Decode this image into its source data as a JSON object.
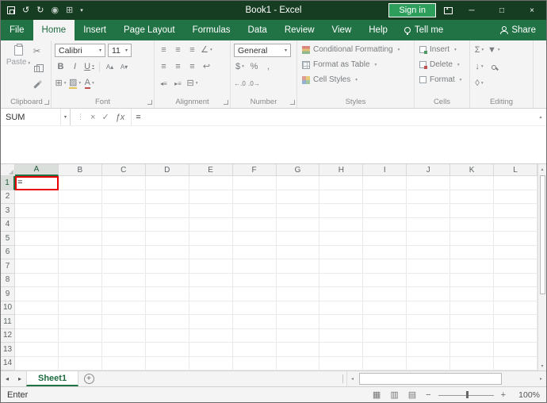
{
  "colors": {
    "title_bar": "#163D22",
    "ribbon_green": "#217346",
    "sign_in_green": "#2F9E5C",
    "active_tab_text": "#1E6B41",
    "selection_border_red": "#E60000",
    "sheet_tab_underline": "#217346"
  },
  "titlebar": {
    "title": "Book1 - Excel",
    "sign_in": "Sign in"
  },
  "tabs": {
    "file": "File",
    "items": [
      "Home",
      "Insert",
      "Page Layout",
      "Formulas",
      "Data",
      "Review",
      "View",
      "Help"
    ],
    "active": "Home",
    "tell_me": "Tell me",
    "share": "Share"
  },
  "ribbon": {
    "clipboard": {
      "label": "Clipboard",
      "paste": "Paste"
    },
    "font": {
      "label": "Font",
      "family": "Calibri",
      "size": "11"
    },
    "alignment": {
      "label": "Alignment"
    },
    "number": {
      "label": "Number",
      "format": "General"
    },
    "styles": {
      "label": "Styles",
      "conditional_formatting": "Conditional Formatting",
      "format_as_table": "Format as Table",
      "cell_styles": "Cell Styles"
    },
    "cells": {
      "label": "Cells",
      "insert": "Insert",
      "delete": "Delete",
      "format": "Format"
    },
    "editing": {
      "label": "Editing"
    }
  },
  "formula_bar": {
    "name_box": "SUM",
    "content": "="
  },
  "grid": {
    "columns": [
      "A",
      "B",
      "C",
      "D",
      "E",
      "F",
      "G",
      "H",
      "I",
      "J",
      "K",
      "L"
    ],
    "rows": [
      "1",
      "2",
      "3",
      "4",
      "5",
      "6",
      "7",
      "8",
      "9",
      "10",
      "11",
      "12",
      "13",
      "14"
    ],
    "active_cell": {
      "col": "A",
      "row": "1",
      "ref": "A1",
      "value": "="
    }
  },
  "sheets": {
    "tabs": [
      "Sheet1"
    ]
  },
  "status_bar": {
    "mode": "Enter",
    "zoom": "100%"
  },
  "icons": {
    "undo": "↺",
    "redo": "↻",
    "touch_mode": "◉",
    "qat_grid": "⊞",
    "dropdown": "▾",
    "minimize": "─",
    "maximize": "□",
    "close": "×",
    "cut": "✂",
    "bold": "B",
    "italic": "I",
    "underline": "U",
    "grow_font": "A▴",
    "shrink_font": "A▾",
    "align_lines": "≡",
    "orientation": "∠",
    "wrap_text": "↩",
    "indent_left": "◂≡",
    "indent_right": "▸≡",
    "merge_center": "⊟",
    "borders": "⊞",
    "fill_color": "▨",
    "font_color": "A",
    "currency": "$",
    "percent": "%",
    "comma": ",",
    "inc_decimal": "←.0",
    "dec_decimal": ".0→",
    "autosum": "Σ",
    "fill_down": "↓",
    "sort_filter": "▼",
    "clear": "◊",
    "cancel": "×",
    "enter": "✓",
    "fx": "ƒx",
    "dots": "⋮",
    "nav_left": "◂",
    "nav_right": "▸",
    "up": "▴",
    "down": "▾",
    "new_sheet": "+",
    "zoom_out": "−",
    "zoom_in": "+",
    "view_normal": "▦",
    "view_layout": "▥",
    "view_break": "▤",
    "collapse_formula": "▴"
  }
}
